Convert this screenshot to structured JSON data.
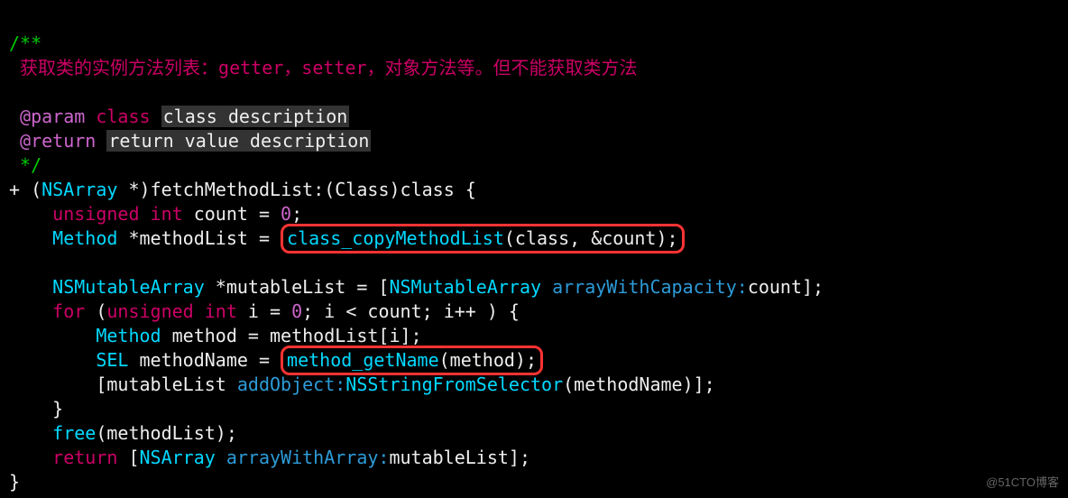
{
  "comment": {
    "open": "/**",
    "desc_prefix": " ",
    "desc_zh": "获取类的实例方法列表：getter，setter，对象方法等。但不能获取类方法",
    "blank": "",
    "param_tag": " @param",
    "param_type": "class",
    "param_desc": "class description",
    "return_tag": " @return",
    "return_desc": "return value description",
    "close": " */"
  },
  "code": {
    "l1_plus": "+ ",
    "l1_open": "(",
    "l1_type": "NSArray",
    "l1_star": " *",
    "l1_close": ")",
    "l1_method": "fetchMethodList:",
    "l1_pOpen": "(",
    "l1_pType": "Class",
    "l1_pClose": ")",
    "l1_pName": "class",
    "l1_brace": " {",
    "l2_kw1": "unsigned",
    "l2_kw2": "int",
    "l2_rest": " count = ",
    "l2_num": "0",
    "l2_semi": ";",
    "l3_type": "Method",
    "l3_mid": " *methodList = ",
    "l3_boxed_call": "class_copyMethodList",
    "l3_boxed_args": "(class, &count);",
    "l5_type": "NSMutableArray",
    "l5_mid": " *mutableList = [",
    "l5_cls": "NSMutableArray",
    "l5_sel": " arrayWithCapacity:",
    "l5_end": "count];",
    "l6_for": "for",
    "l6_open": " (",
    "l6_kw1": "unsigned",
    "l6_kw2": "int",
    "l6_mid": " i = ",
    "l6_n0": "0",
    "l6_rest": "; i < count; i++ ) {",
    "l7_type": "Method",
    "l7_rest": " method = methodList[i];",
    "l8_type": "SEL",
    "l8_mid": " methodName = ",
    "l8_boxed_call": "method_getName",
    "l8_boxed_args": "(method);",
    "l9_open": "[mutableList ",
    "l9_sel": "addObject:",
    "l9_fn": "NSStringFromSelector",
    "l9_end": "(methodName)];",
    "l10": "}",
    "l11_fn": "free",
    "l11_rest": "(methodList);",
    "l12_kw": "return",
    "l12_open": " [",
    "l12_cls": "NSArray",
    "l12_sel": " arrayWithArray:",
    "l12_end": "mutableList];",
    "l13": "}"
  },
  "watermark": "@51CTO博客"
}
